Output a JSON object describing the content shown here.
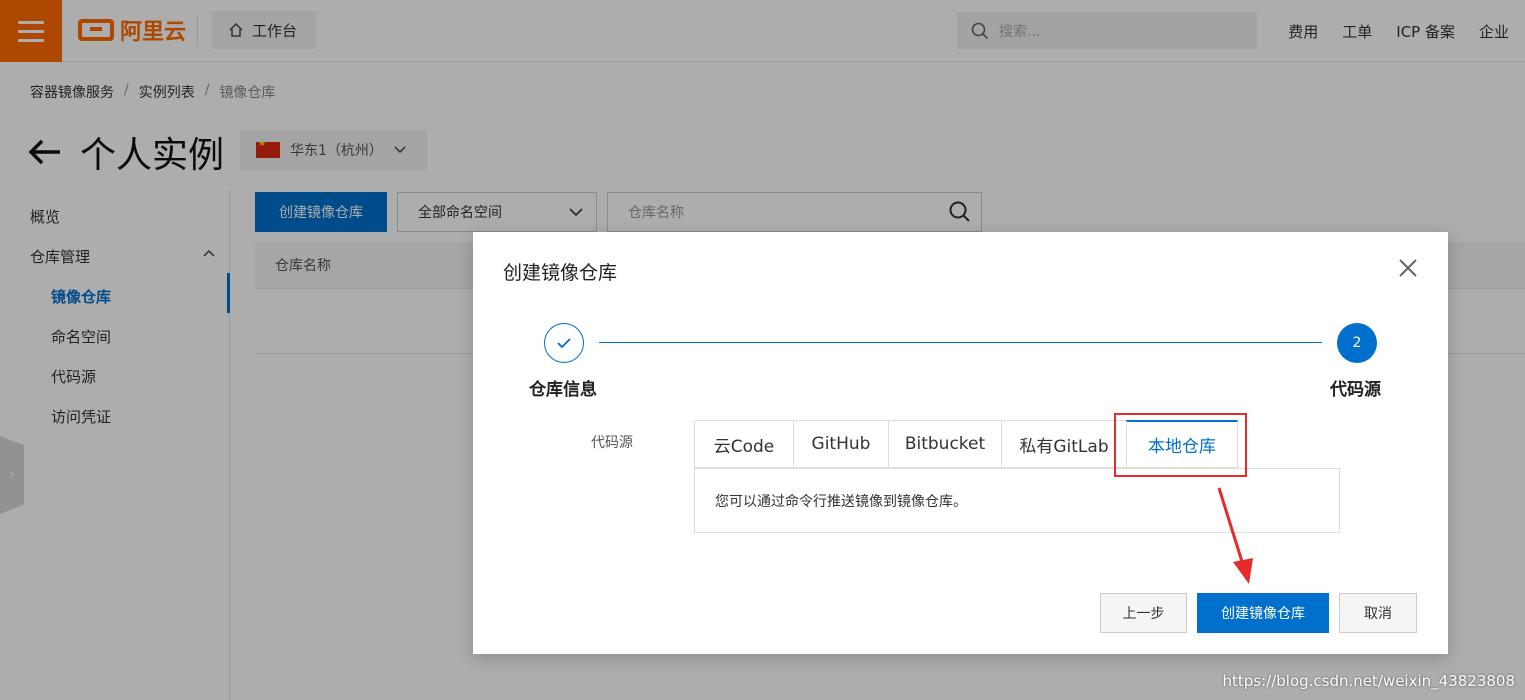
{
  "topbar": {
    "logo_text": "阿里云",
    "workbench_label": "工作台",
    "search_placeholder": "搜索...",
    "links": [
      "费用",
      "工单",
      "ICP 备案",
      "企业"
    ]
  },
  "breadcrumb": [
    "容器镜像服务",
    "实例列表",
    "镜像仓库"
  ],
  "page_title": "个人实例",
  "region": "华东1（杭州）",
  "sidebar": {
    "overview": "概览",
    "repo_mgmt": "仓库管理",
    "sub_items": [
      "镜像仓库",
      "命名空间",
      "代码源",
      "访问凭证"
    ],
    "active_index": 0
  },
  "toolbar": {
    "create_label": "创建镜像仓库",
    "namespace_select": "全部命名空间",
    "repo_search_placeholder": "仓库名称"
  },
  "table": {
    "header": "仓库名称"
  },
  "dialog": {
    "title": "创建镜像仓库",
    "steps": [
      {
        "label": "仓库信息",
        "status": "done"
      },
      {
        "label": "代码源",
        "number": "2",
        "status": "current"
      }
    ],
    "source_label": "代码源",
    "tabs": [
      "云Code",
      "GitHub",
      "Bitbucket",
      "私有GitLab",
      "本地仓库"
    ],
    "active_tab": 4,
    "panel_text": "您可以通过命令行推送镜像到镜像仓库。",
    "buttons": {
      "prev": "上一步",
      "create": "创建镜像仓库",
      "cancel": "取消"
    }
  },
  "watermark": "https://blog.csdn.net/weixin_43823808",
  "colors": {
    "brand": "#ff6a00",
    "primary": "#0070cc",
    "highlight": "#e52b2b"
  }
}
